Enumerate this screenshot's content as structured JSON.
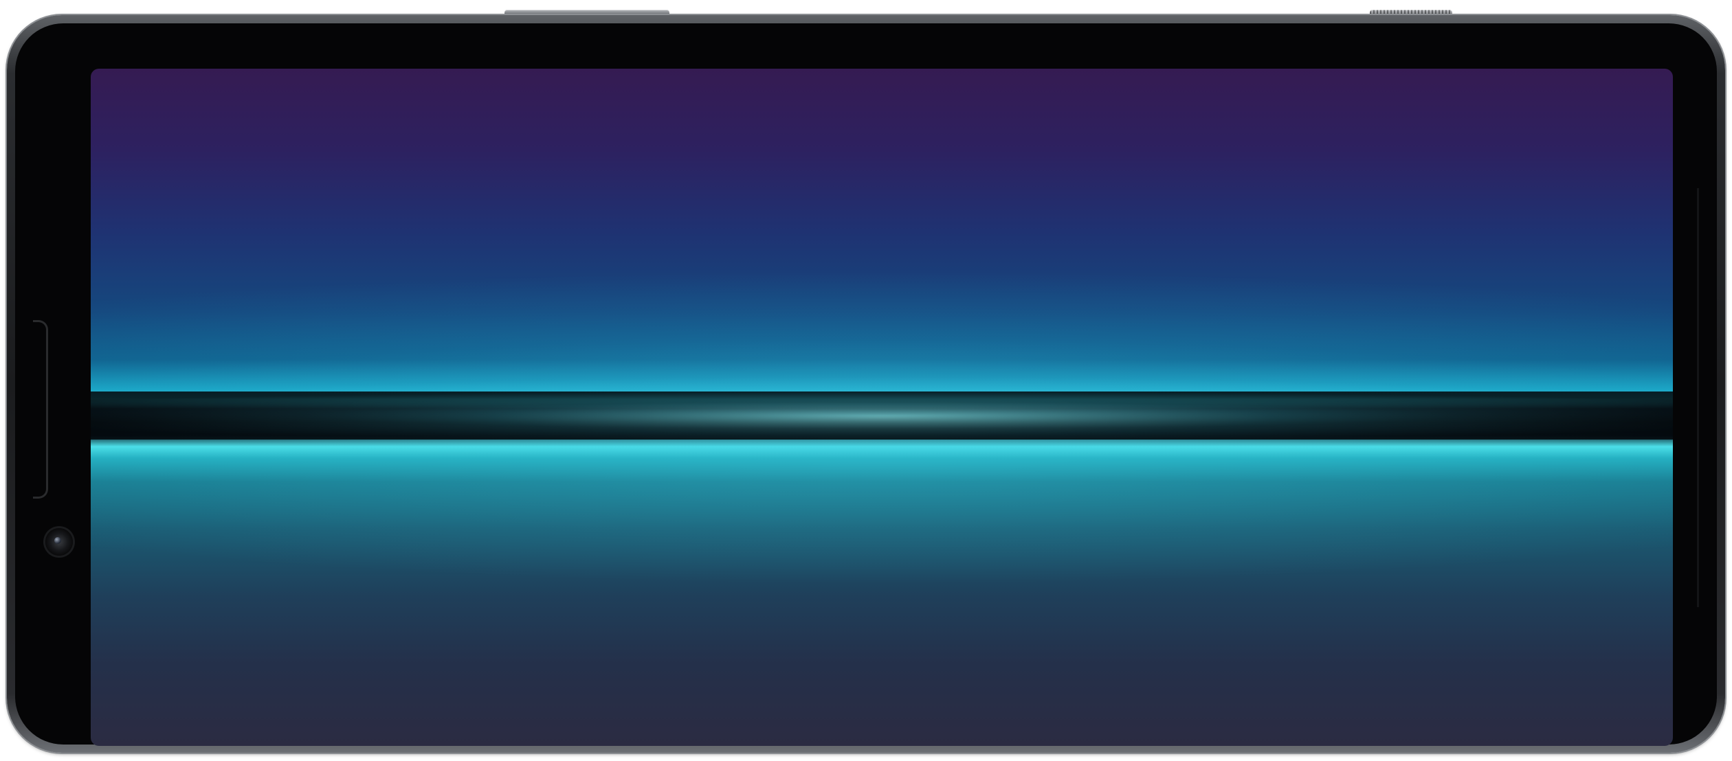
{
  "device": {
    "kind": "smartphone",
    "orientation": "landscape",
    "frame_color": "#1b1c1e",
    "screen": {
      "content": "wallpaper",
      "wallpaper_colors": {
        "top": "#351b52",
        "upper_mid": "#15487e",
        "light_band": "#36e0f0",
        "dark_band": "#050608",
        "lower_mid": "#1a5a72",
        "bottom": "#2b2b42"
      }
    },
    "icons": {
      "front_camera": "camera-lens-icon",
      "speaker": "speaker-slot"
    }
  }
}
